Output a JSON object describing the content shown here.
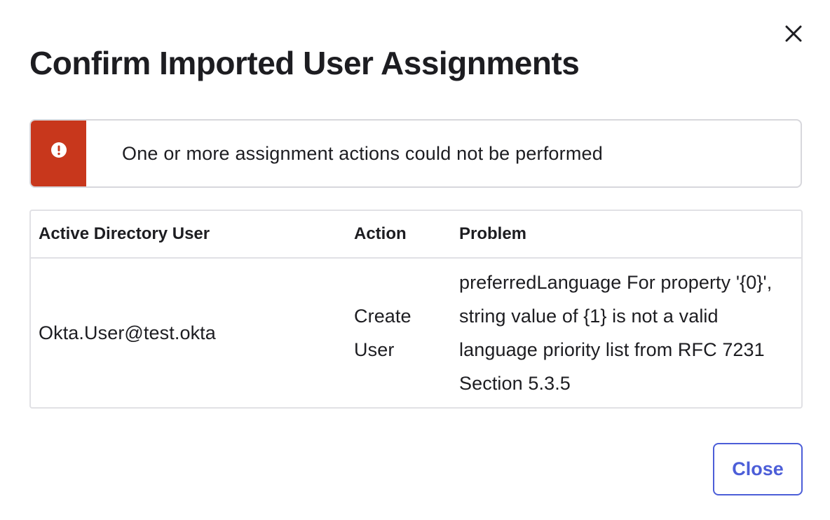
{
  "dialog": {
    "title": "Confirm Imported User Assignments",
    "close_icon": "close-icon"
  },
  "alert": {
    "icon": "exclamation-circle-icon",
    "message": "One or more assignment actions could not be performed",
    "accent_color": "#c8371c"
  },
  "table": {
    "headers": {
      "user": "Active Directory User",
      "action": "Action",
      "problem": "Problem"
    },
    "rows": [
      {
        "user": "Okta.User@test.okta",
        "action": "Create User",
        "problem": "preferredLanguage For property '{0}', string value of {1} is not a valid language priority list from RFC 7231 Section 5.3.5"
      }
    ]
  },
  "footer": {
    "close_label": "Close",
    "accent_color": "#4c5ed8"
  }
}
